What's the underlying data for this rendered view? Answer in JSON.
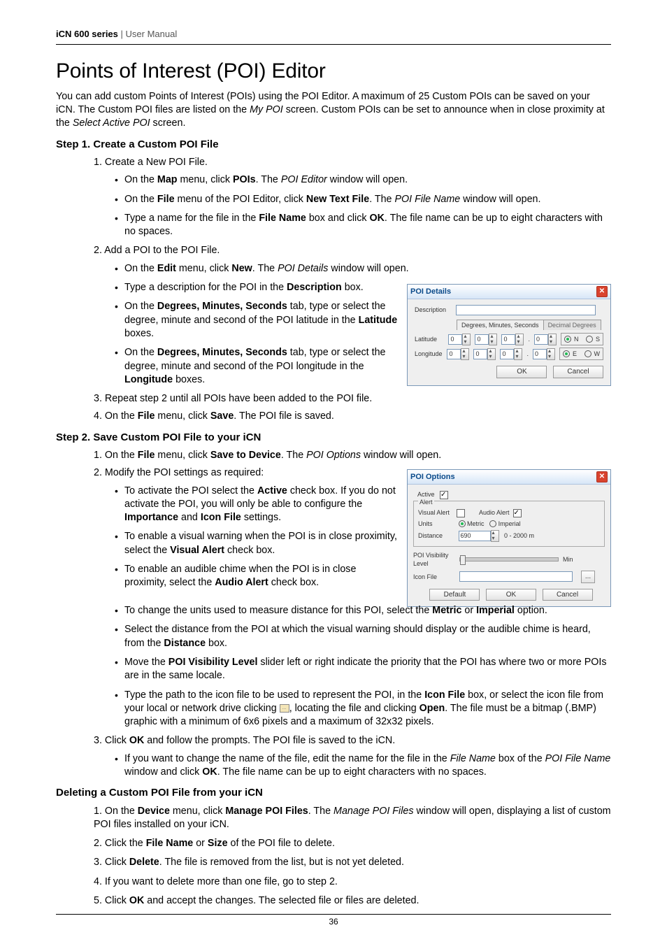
{
  "header": {
    "series": "iCN 600 series",
    "sep": " | ",
    "doc": "User Manual"
  },
  "h1": "Points of Interest (POI) Editor",
  "intro": {
    "t1": "You can add custom Points of Interest (POIs) using the POI Editor. A maximum of 25 Custom POIs can be saved on your iCN. The Custom POI files are listed on the ",
    "i1": "My POI",
    "t2": " screen. Custom POIs can be set to announce when in close proximity at the ",
    "i2": "Select Active POI",
    "t3": " screen."
  },
  "step1": {
    "title": "Step 1. Create a Custom POI File",
    "s1": "1. Create a New POI File.",
    "b1": {
      "a": "On the ",
      "b": "Map",
      "c": " menu, click ",
      "d": "POIs",
      "e": ". The ",
      "f": "POI Editor",
      "g": " window will open."
    },
    "b2": {
      "a": "On the ",
      "b": "File",
      "c": " menu of the POI Editor, click ",
      "d": "New Text File",
      "e": ". The ",
      "f": "POI File Name",
      "g": " window will open."
    },
    "b3": {
      "a": "Type a name for the file in the ",
      "b": "File Name",
      "c": " box and click ",
      "d": "OK",
      "e": ". The file name can be up to eight characters with no spaces."
    },
    "s2": "2. Add a POI to the POI File.",
    "b4": {
      "a": "On the ",
      "b": "Edit",
      "c": " menu, click ",
      "d": "New",
      "e": ". The ",
      "f": "POI Details",
      "g": " window will open."
    },
    "b5": {
      "a": "Type a description for the POI in the ",
      "b": "Description",
      "c": " box."
    },
    "b6": {
      "a": "On the ",
      "b": "Degrees, Minutes, Seconds",
      "c": " tab, type or select the degree, minute and second of the POI latitude in the ",
      "d": "Latitude",
      "e": " boxes."
    },
    "b7": {
      "a": "On the ",
      "b": "Degrees, Minutes, Seconds",
      "c": " tab, type or select the degree, minute and second of the POI longitude in the ",
      "d": "Longitude",
      "e": " boxes."
    },
    "s3": "3. Repeat step 2 until all POIs have been added to the POI file.",
    "s4": {
      "a": "4. On the ",
      "b": "File",
      "c": " menu, click ",
      "d": "Save",
      "e": ". The POI file is saved."
    }
  },
  "poidetails": {
    "title": "POI Details",
    "desc": "Description",
    "tab1": "Degrees, Minutes, Seconds",
    "tab2": "Decimal Degrees",
    "lat": "Latitude",
    "lon": "Longitude",
    "zero": "0",
    "dot": ".",
    "rN": "N",
    "rS": "S",
    "rE": "E",
    "rW": "W",
    "ok": "OK",
    "cancel": "Cancel"
  },
  "step2": {
    "title": "Step 2. Save Custom POI File to your iCN",
    "s1": {
      "a": "1. On the ",
      "b": "File",
      "c": " menu, click ",
      "d": "Save to Device",
      "e": ". The ",
      "f": "POI Options",
      "g": " window will open."
    },
    "s2": "2. Modify the POI settings as required:",
    "b1": {
      "a": "To activate the POI select the ",
      "b": "Active",
      "c": " check box. If you do not activate the POI, you will only be able to configure the ",
      "d": "Importance",
      "e": " and ",
      "f": "Icon File",
      "g": " settings."
    },
    "b2": {
      "a": "To enable a visual warning when the POI is in close proximity, select the ",
      "b": "Visual Alert",
      "c": " check box."
    },
    "b3": {
      "a": "To enable an audible chime when the POI is in close proximity, select the ",
      "b": "Audio Alert",
      "c": " check box."
    },
    "b4": {
      "a": "To change the units used to measure distance for this POI, select the ",
      "b": "Metric",
      "c": " or ",
      "d": "Imperial",
      "e": " option."
    },
    "b5": {
      "a": "Select the distance from the POI at which the visual warning should display or the audible chime is heard, from the ",
      "b": "Distance",
      "c": " box."
    },
    "b6": {
      "a": "Move the ",
      "b": "POI Visibility Level",
      "c": " slider left or right indicate the priority that the POI has where two or more POIs are in the same locale."
    },
    "b7": {
      "a": "Type the path to the icon file to be used to represent the POI, in the ",
      "b": "Icon File",
      "c": " box, or select the icon file from your local or network drive clicking ",
      "d": ", locating the file and clicking ",
      "e": "Open",
      "f": ". The file must be a bitmap (.BMP)  graphic with a minimum of 6x6 pixels and a maximum of 32x32 pixels."
    },
    "s3": {
      "a": "3. Click ",
      "b": "OK",
      "c": " and follow the prompts. The POI file is saved to the iCN."
    },
    "b8": {
      "a": "If you want to change the name of the file, edit the name for the file in the ",
      "b": "File Name",
      "c": " box of the ",
      "d": "POI File Name",
      "e": " window and click ",
      "f": "OK",
      "g": ". The file name can be up to eight characters with no spaces."
    }
  },
  "poioptions": {
    "title": "POI Options",
    "active": "Active",
    "alertlegend": "Alert",
    "visual": "Visual Alert",
    "audio": "Audio Alert",
    "units": "Units",
    "metric": "Metric",
    "imperial": "Imperial",
    "distance": "Distance",
    "distval": "690",
    "range": "0 - 2000 m",
    "vis": "POI Visibility Level",
    "min": "Min",
    "iconfile": "Icon File",
    "default": "Default",
    "ok": "OK",
    "cancel": "Cancel",
    "browse": "..."
  },
  "delete": {
    "title": "Deleting a Custom POI File from your iCN",
    "s1": {
      "a": "1. On the ",
      "b": "Device",
      "c": " menu, click ",
      "d": "Manage POI Files",
      "e": ". The ",
      "f": "Manage POI Files",
      "g": " window will open, displaying a list of custom POI files installed on your iCN."
    },
    "s2": {
      "a": "2. Click the ",
      "b": "File Name",
      "c": " or ",
      "d": "Size",
      "e": " of the POI file to delete."
    },
    "s3": {
      "a": "3. Click ",
      "b": "Delete",
      "c": ". The file is removed from the list, but is not yet deleted."
    },
    "s4": "4. If you want to delete more than one file, go to step 2.",
    "s5": {
      "a": "5. Click ",
      "b": "OK",
      "c": " and accept the changes. The selected file or files are deleted."
    }
  },
  "pagenum": "36",
  "icons": {
    "close": "✕"
  }
}
